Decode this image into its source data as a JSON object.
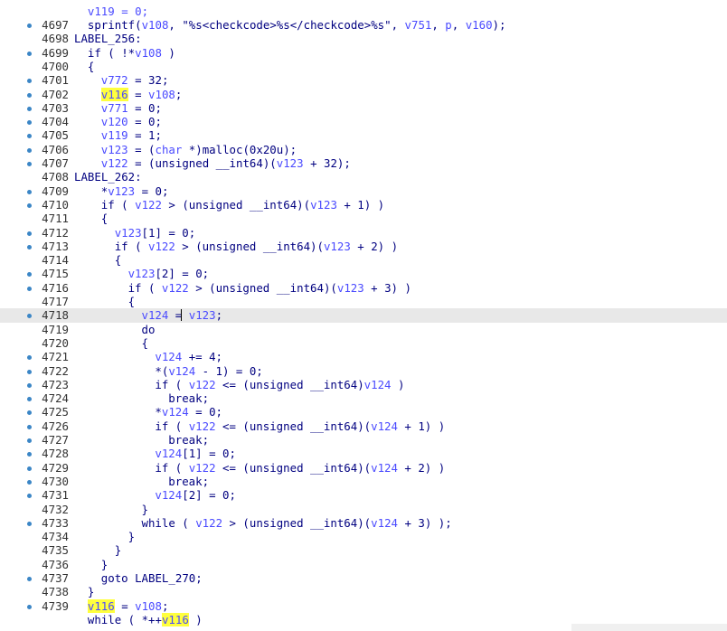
{
  "editor": {
    "first_line_partial": "    v119 = 0;",
    "lines": [
      {
        "num": "4697",
        "bullet": true,
        "tokens": [
          {
            "t": "sprintf(",
            "c": "kw"
          },
          {
            "t": "v108",
            "c": "var"
          },
          {
            "t": ", ",
            "c": "kw"
          },
          {
            "t": "\"%s<checkcode>%s</checkcode>%s\"",
            "c": "str-fmt"
          },
          {
            "t": ", ",
            "c": "kw"
          },
          {
            "t": "v751",
            "c": "var"
          },
          {
            "t": ", ",
            "c": "kw"
          },
          {
            "t": "p",
            "c": "var"
          },
          {
            "t": ", ",
            "c": "kw"
          },
          {
            "t": "v160",
            "c": "var"
          },
          {
            "t": ");",
            "c": "kw"
          }
        ],
        "indent": 1
      },
      {
        "num": "4698",
        "bullet": false,
        "tokens": [
          {
            "t": "LABEL_256:",
            "c": "kw"
          }
        ],
        "indent": 0
      },
      {
        "num": "4699",
        "bullet": true,
        "tokens": [
          {
            "t": "if ( !*",
            "c": "kw"
          },
          {
            "t": "v108",
            "c": "var"
          },
          {
            "t": " )",
            "c": "kw"
          }
        ],
        "indent": 1
      },
      {
        "num": "4700",
        "bullet": false,
        "tokens": [
          {
            "t": "{",
            "c": "kw"
          }
        ],
        "indent": 1
      },
      {
        "num": "4701",
        "bullet": true,
        "tokens": [
          {
            "t": "v772",
            "c": "var"
          },
          {
            "t": " = 32;",
            "c": "kw"
          }
        ],
        "indent": 2
      },
      {
        "num": "4702",
        "bullet": true,
        "tokens": [
          {
            "t": "v116",
            "c": "hl"
          },
          {
            "t": " = ",
            "c": "kw"
          },
          {
            "t": "v108",
            "c": "var"
          },
          {
            "t": ";",
            "c": "kw"
          }
        ],
        "indent": 2
      },
      {
        "num": "4703",
        "bullet": true,
        "tokens": [
          {
            "t": "v771",
            "c": "var"
          },
          {
            "t": " = 0;",
            "c": "kw"
          }
        ],
        "indent": 2
      },
      {
        "num": "4704",
        "bullet": true,
        "tokens": [
          {
            "t": "v120",
            "c": "var"
          },
          {
            "t": " = 0;",
            "c": "kw"
          }
        ],
        "indent": 2
      },
      {
        "num": "4705",
        "bullet": true,
        "tokens": [
          {
            "t": "v119",
            "c": "var"
          },
          {
            "t": " = 1;",
            "c": "kw"
          }
        ],
        "indent": 2
      },
      {
        "num": "4706",
        "bullet": true,
        "tokens": [
          {
            "t": "v123",
            "c": "var"
          },
          {
            "t": " = (",
            "c": "kw"
          },
          {
            "t": "char",
            "c": "var"
          },
          {
            "t": " *)malloc(0x20u);",
            "c": "kw"
          }
        ],
        "indent": 2
      },
      {
        "num": "4707",
        "bullet": true,
        "tokens": [
          {
            "t": "v122",
            "c": "var"
          },
          {
            "t": " = (unsigned __int64)(",
            "c": "kw"
          },
          {
            "t": "v123",
            "c": "var"
          },
          {
            "t": " + 32);",
            "c": "kw"
          }
        ],
        "indent": 2
      },
      {
        "num": "4708",
        "bullet": false,
        "tokens": [
          {
            "t": "LABEL_262:",
            "c": "kw"
          }
        ],
        "indent": 0
      },
      {
        "num": "4709",
        "bullet": true,
        "tokens": [
          {
            "t": "*",
            "c": "kw"
          },
          {
            "t": "v123",
            "c": "var"
          },
          {
            "t": " = 0;",
            "c": "kw"
          }
        ],
        "indent": 2
      },
      {
        "num": "4710",
        "bullet": true,
        "tokens": [
          {
            "t": "if ( ",
            "c": "kw"
          },
          {
            "t": "v122",
            "c": "var"
          },
          {
            "t": " > (unsigned __int64)(",
            "c": "kw"
          },
          {
            "t": "v123",
            "c": "var"
          },
          {
            "t": " + 1) )",
            "c": "kw"
          }
        ],
        "indent": 2
      },
      {
        "num": "4711",
        "bullet": false,
        "tokens": [
          {
            "t": "{",
            "c": "kw"
          }
        ],
        "indent": 2
      },
      {
        "num": "4712",
        "bullet": true,
        "tokens": [
          {
            "t": "v123",
            "c": "var"
          },
          {
            "t": "[1] = 0;",
            "c": "kw"
          }
        ],
        "indent": 3
      },
      {
        "num": "4713",
        "bullet": true,
        "tokens": [
          {
            "t": "if ( ",
            "c": "kw"
          },
          {
            "t": "v122",
            "c": "var"
          },
          {
            "t": " > (unsigned __int64)(",
            "c": "kw"
          },
          {
            "t": "v123",
            "c": "var"
          },
          {
            "t": " + 2) )",
            "c": "kw"
          }
        ],
        "indent": 3
      },
      {
        "num": "4714",
        "bullet": false,
        "tokens": [
          {
            "t": "{",
            "c": "kw"
          }
        ],
        "indent": 3
      },
      {
        "num": "4715",
        "bullet": true,
        "tokens": [
          {
            "t": "v123",
            "c": "var"
          },
          {
            "t": "[2] = 0;",
            "c": "kw"
          }
        ],
        "indent": 4
      },
      {
        "num": "4716",
        "bullet": true,
        "tokens": [
          {
            "t": "if ( ",
            "c": "kw"
          },
          {
            "t": "v122",
            "c": "var"
          },
          {
            "t": " > (unsigned __int64)(",
            "c": "kw"
          },
          {
            "t": "v123",
            "c": "var"
          },
          {
            "t": " + 3) )",
            "c": "kw"
          }
        ],
        "indent": 4
      },
      {
        "num": "4717",
        "bullet": false,
        "tokens": [
          {
            "t": "{",
            "c": "kw"
          }
        ],
        "indent": 4
      },
      {
        "num": "4718",
        "bullet": true,
        "current": true,
        "tokens": [
          {
            "t": "v124",
            "c": "var"
          },
          {
            "t": " =",
            "c": "kw",
            "caret": true
          },
          {
            "t": " ",
            "c": "kw"
          },
          {
            "t": "v123",
            "c": "var"
          },
          {
            "t": ";",
            "c": "kw"
          }
        ],
        "indent": 5
      },
      {
        "num": "4719",
        "bullet": false,
        "tokens": [
          {
            "t": "do",
            "c": "kw"
          }
        ],
        "indent": 5
      },
      {
        "num": "4720",
        "bullet": false,
        "tokens": [
          {
            "t": "{",
            "c": "kw"
          }
        ],
        "indent": 5
      },
      {
        "num": "4721",
        "bullet": true,
        "tokens": [
          {
            "t": "v124",
            "c": "var"
          },
          {
            "t": " += 4;",
            "c": "kw"
          }
        ],
        "indent": 6
      },
      {
        "num": "4722",
        "bullet": true,
        "tokens": [
          {
            "t": "*(",
            "c": "kw"
          },
          {
            "t": "v124",
            "c": "var"
          },
          {
            "t": " - 1) = 0;",
            "c": "kw"
          }
        ],
        "indent": 6
      },
      {
        "num": "4723",
        "bullet": true,
        "tokens": [
          {
            "t": "if ( ",
            "c": "kw"
          },
          {
            "t": "v122",
            "c": "var"
          },
          {
            "t": " <= (unsigned __int64)",
            "c": "kw"
          },
          {
            "t": "v124",
            "c": "var"
          },
          {
            "t": " )",
            "c": "kw"
          }
        ],
        "indent": 6
      },
      {
        "num": "4724",
        "bullet": true,
        "tokens": [
          {
            "t": "break;",
            "c": "kw"
          }
        ],
        "indent": 7
      },
      {
        "num": "4725",
        "bullet": true,
        "tokens": [
          {
            "t": "*",
            "c": "kw"
          },
          {
            "t": "v124",
            "c": "var"
          },
          {
            "t": " = 0;",
            "c": "kw"
          }
        ],
        "indent": 6
      },
      {
        "num": "4726",
        "bullet": true,
        "tokens": [
          {
            "t": "if ( ",
            "c": "kw"
          },
          {
            "t": "v122",
            "c": "var"
          },
          {
            "t": " <= (unsigned __int64)(",
            "c": "kw"
          },
          {
            "t": "v124",
            "c": "var"
          },
          {
            "t": " + 1) )",
            "c": "kw"
          }
        ],
        "indent": 6
      },
      {
        "num": "4727",
        "bullet": true,
        "tokens": [
          {
            "t": "break;",
            "c": "kw"
          }
        ],
        "indent": 7
      },
      {
        "num": "4728",
        "bullet": true,
        "tokens": [
          {
            "t": "v124",
            "c": "var"
          },
          {
            "t": "[1] = 0;",
            "c": "kw"
          }
        ],
        "indent": 6
      },
      {
        "num": "4729",
        "bullet": true,
        "tokens": [
          {
            "t": "if ( ",
            "c": "kw"
          },
          {
            "t": "v122",
            "c": "var"
          },
          {
            "t": " <= (unsigned __int64)(",
            "c": "kw"
          },
          {
            "t": "v124",
            "c": "var"
          },
          {
            "t": " + 2) )",
            "c": "kw"
          }
        ],
        "indent": 6
      },
      {
        "num": "4730",
        "bullet": true,
        "tokens": [
          {
            "t": "break;",
            "c": "kw"
          }
        ],
        "indent": 7
      },
      {
        "num": "4731",
        "bullet": true,
        "tokens": [
          {
            "t": "v124",
            "c": "var"
          },
          {
            "t": "[2] = 0;",
            "c": "kw"
          }
        ],
        "indent": 6
      },
      {
        "num": "4732",
        "bullet": false,
        "tokens": [
          {
            "t": "}",
            "c": "kw"
          }
        ],
        "indent": 5
      },
      {
        "num": "4733",
        "bullet": true,
        "tokens": [
          {
            "t": "while ( ",
            "c": "kw"
          },
          {
            "t": "v122",
            "c": "var"
          },
          {
            "t": " > (unsigned __int64)(",
            "c": "kw"
          },
          {
            "t": "v124",
            "c": "var"
          },
          {
            "t": " + 3) );",
            "c": "kw"
          }
        ],
        "indent": 5
      },
      {
        "num": "4734",
        "bullet": false,
        "tokens": [
          {
            "t": "}",
            "c": "kw"
          }
        ],
        "indent": 4
      },
      {
        "num": "4735",
        "bullet": false,
        "tokens": [
          {
            "t": "}",
            "c": "kw"
          }
        ],
        "indent": 3
      },
      {
        "num": "4736",
        "bullet": false,
        "tokens": [
          {
            "t": "}",
            "c": "kw"
          }
        ],
        "indent": 2
      },
      {
        "num": "4737",
        "bullet": true,
        "tokens": [
          {
            "t": "goto LABEL_270;",
            "c": "kw"
          }
        ],
        "indent": 2
      },
      {
        "num": "4738",
        "bullet": false,
        "tokens": [
          {
            "t": "}",
            "c": "kw"
          }
        ],
        "indent": 1
      },
      {
        "num": "4739",
        "bullet": true,
        "tokens": [
          {
            "t": "v116",
            "c": "hl"
          },
          {
            "t": " = ",
            "c": "kw"
          },
          {
            "t": "v108",
            "c": "var"
          },
          {
            "t": ";",
            "c": "kw"
          }
        ],
        "indent": 1
      },
      {
        "num": "",
        "bullet": false,
        "tokens": [
          {
            "t": "while ( *++",
            "c": "kw"
          },
          {
            "t": "v116",
            "c": "hl"
          },
          {
            "t": " )",
            "c": "kw"
          }
        ],
        "indent": 1
      }
    ]
  },
  "colors": {
    "keyword": "#000080",
    "variable": "#4a4aff",
    "highlight": "#ffff3d",
    "bullet": "#3b86c6",
    "current_line": "#e8e8e8"
  }
}
